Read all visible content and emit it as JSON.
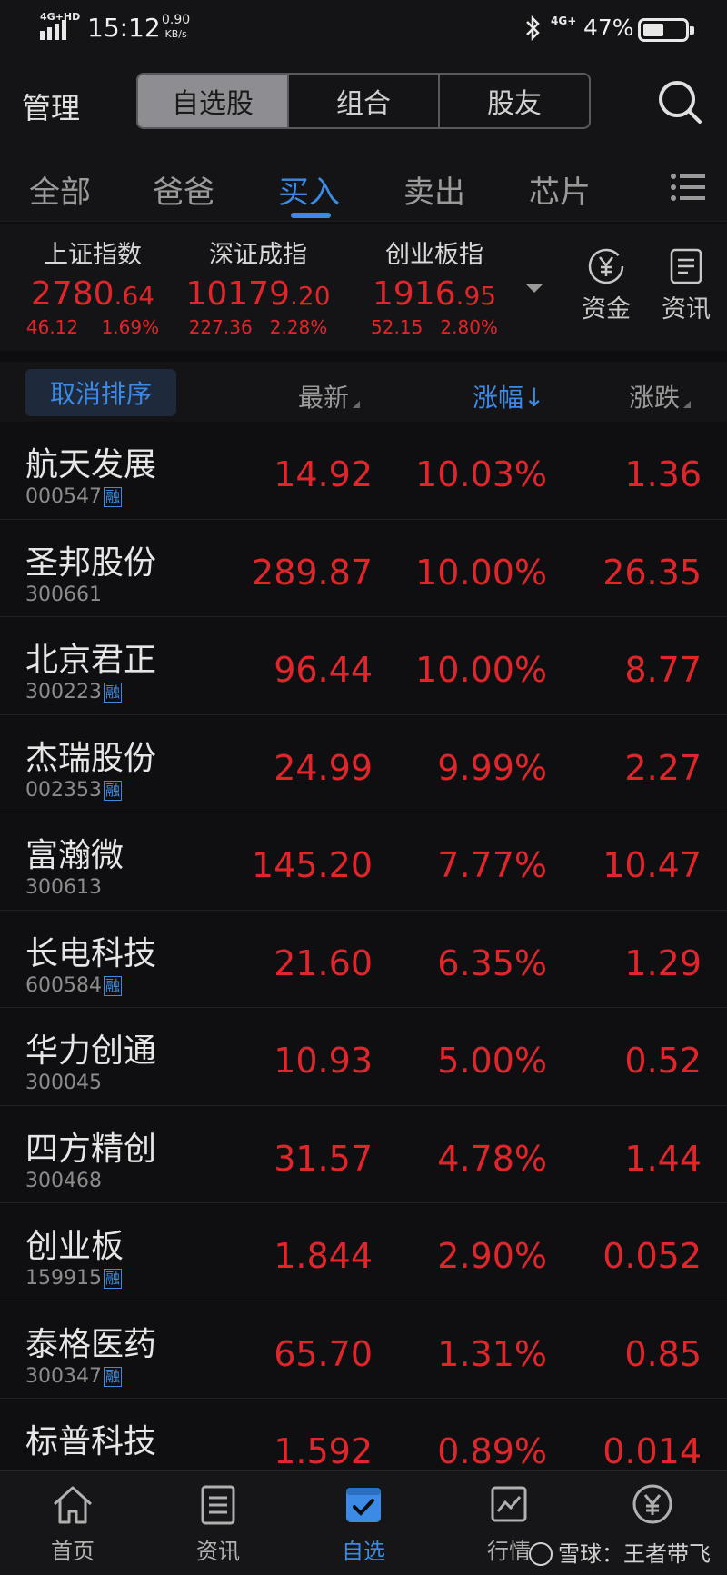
{
  "status_bar": {
    "network": "4G+HD",
    "time": "15:12",
    "speed_value": "0.90",
    "speed_unit": "KB/s",
    "mobile": "4G+",
    "battery": "47%",
    "battery_level": 0.47
  },
  "header": {
    "manage": "管理",
    "segments": [
      "自选股",
      "组合",
      "股友"
    ],
    "active_segment": 0
  },
  "tabs": [
    "全部",
    "爸爸",
    "买入",
    "卖出",
    "芯片"
  ],
  "active_tab": 2,
  "indices": [
    {
      "name": "上证指数",
      "int": "2780",
      "dec": ".64",
      "change": "46.12",
      "percent": "1.69%"
    },
    {
      "name": "深证成指",
      "int": "10179",
      "dec": ".20",
      "change": "227.36",
      "percent": "2.28%"
    },
    {
      "name": "创业板指",
      "int": "1916",
      "dec": ".95",
      "change": "52.15",
      "percent": "2.80%"
    }
  ],
  "side_buttons": {
    "funds": "资金",
    "news": "资讯"
  },
  "sort_header": {
    "cancel": "取消排序",
    "latest": "最新",
    "change_pct": "涨幅",
    "change": "涨跌"
  },
  "stocks": [
    {
      "name": "航天发展",
      "code": "000547",
      "margin": true,
      "price": "14.92",
      "pct": "10.03%",
      "chg": "1.36"
    },
    {
      "name": "圣邦股份",
      "code": "300661",
      "margin": false,
      "price": "289.87",
      "pct": "10.00%",
      "chg": "26.35"
    },
    {
      "name": "北京君正",
      "code": "300223",
      "margin": true,
      "price": "96.44",
      "pct": "10.00%",
      "chg": "8.77"
    },
    {
      "name": "杰瑞股份",
      "code": "002353",
      "margin": true,
      "price": "24.99",
      "pct": "9.99%",
      "chg": "2.27"
    },
    {
      "name": "富瀚微",
      "code": "300613",
      "margin": false,
      "price": "145.20",
      "pct": "7.77%",
      "chg": "10.47"
    },
    {
      "name": "长电科技",
      "code": "600584",
      "margin": true,
      "price": "21.60",
      "pct": "6.35%",
      "chg": "1.29"
    },
    {
      "name": "华力创通",
      "code": "300045",
      "margin": false,
      "price": "10.93",
      "pct": "5.00%",
      "chg": "0.52"
    },
    {
      "name": "四方精创",
      "code": "300468",
      "margin": false,
      "price": "31.57",
      "pct": "4.78%",
      "chg": "1.44"
    },
    {
      "name": "创业板",
      "code": "159915",
      "margin": true,
      "price": "1.844",
      "pct": "2.90%",
      "chg": "0.052"
    },
    {
      "name": "泰格医药",
      "code": "300347",
      "margin": true,
      "price": "65.70",
      "pct": "1.31%",
      "chg": "0.85"
    },
    {
      "name": "标普科技",
      "code": "",
      "margin": false,
      "price": "1.592",
      "pct": "0.89%",
      "chg": "0.014"
    }
  ],
  "margin_label": "融",
  "bottom_nav": [
    "首页",
    "资讯",
    "自选",
    "行情",
    ""
  ],
  "active_nav": 2,
  "watermark": "雪球：王者带飞",
  "colors": {
    "up": "#e0262a",
    "accent": "#3b8be6",
    "background": "#0d0d0f"
  }
}
